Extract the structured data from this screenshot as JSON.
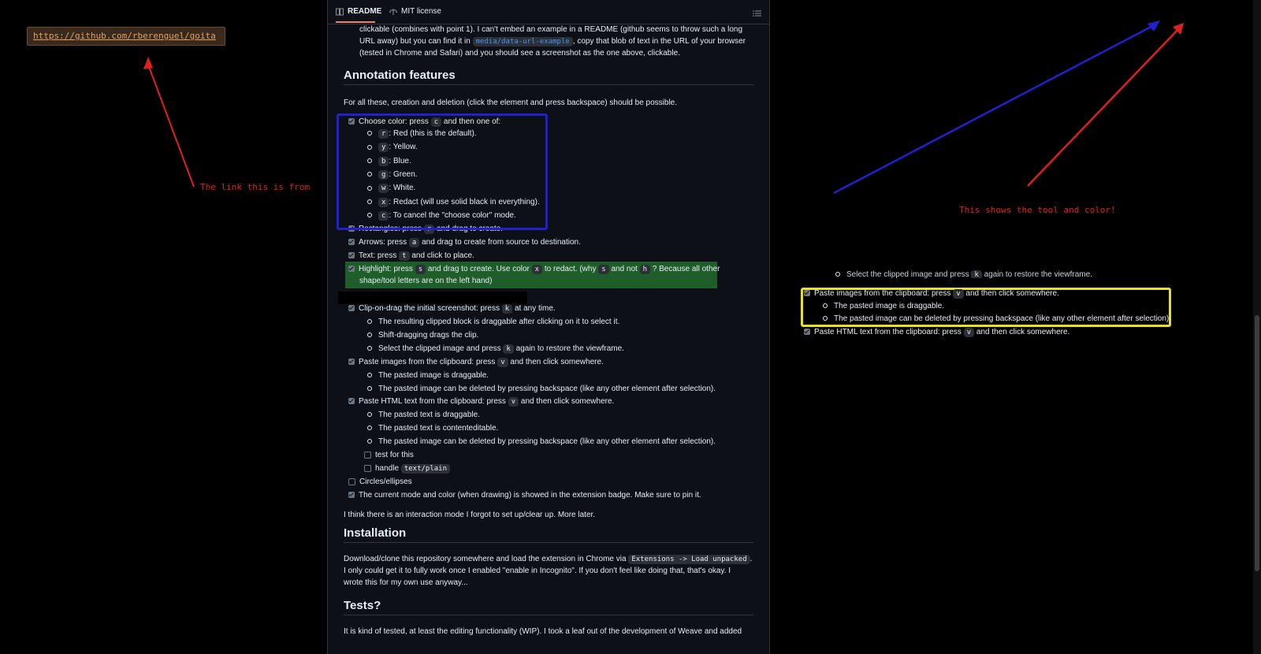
{
  "colors": {
    "page_bg": "#0d1117",
    "outer_bg": "#000000",
    "annotation_red": "#e0201e",
    "annotation_blue": "#2020d0",
    "annotation_yellow": "#e8e020",
    "highlight_green": "#1f5d2a",
    "link_blue": "#4493f8"
  },
  "annotations": {
    "url_box": "https://github.com/rberenguel/goita",
    "link_note": "The link this is from",
    "tool_note": "This shows the tool and color!"
  },
  "tabs": {
    "readme": "README",
    "license": "MIT license",
    "readme_icon": "book-icon",
    "license_icon": "scale-icon",
    "toc_icon": "list-icon"
  },
  "intro": {
    "line1": "clickable (combines with point 1). I can't embed an example in a README (github seems to throw such a long",
    "line2_a": "URL away) but you can find it in",
    "line2_link": "media/data-url-example",
    "line2_b": ", copy that blob of text in the URL of your browser",
    "line3": "(tested in Chrome and Safari) and you should see a screenshot as the one above, clickable."
  },
  "annotation_features": {
    "heading": "Annotation features",
    "intro": "For all these, creation and deletion (click the element and press backspace) should be possible.",
    "choose_color": {
      "a": "Choose color: press",
      "key": "c",
      "b": "and then one of:"
    },
    "colors": [
      {
        "key": "r",
        "text": ": Red (this is the default)."
      },
      {
        "key": "y",
        "text": ": Yellow."
      },
      {
        "key": "b",
        "text": ": Blue."
      },
      {
        "key": "g",
        "text": ": Green."
      },
      {
        "key": "w",
        "text": ": White."
      },
      {
        "key": "x",
        "text": ": Redact (will use solid black in everything)."
      },
      {
        "key": "c",
        "text": ": To cancel the \"choose color\" mode."
      }
    ],
    "rectangles": {
      "a": "Rectangles: press",
      "key": "r",
      "b": "and drag to create."
    },
    "arrows": {
      "a": "Arrows: press",
      "key": "a",
      "b": "and drag to create from source to destination."
    },
    "text": {
      "a": "Text: press",
      "key": "t",
      "b": "and click to place."
    },
    "highlight": {
      "a": "Highlight: press",
      "key1": "s",
      "b": "and drag to create. Use color",
      "key2": "x",
      "c": "to redact. (why",
      "key3": "s",
      "d": "and not",
      "key4": "h",
      "e": "? Because all other",
      "line2": "shape/tool letters are on the left hand)"
    },
    "clip": {
      "a": "Clip-on-drag the initial screenshot: press",
      "key": "k",
      "b": "at any time."
    },
    "clip_sub": [
      "The resulting clipped block is draggable after clicking on it to select it.",
      "Shift-dragging drags the clip."
    ],
    "clip_restore": {
      "a": "Select the clipped image and press",
      "key": "k",
      "b": "again to restore the viewframe."
    },
    "paste_images": {
      "a": "Paste images from the clipboard: press",
      "key": "v",
      "b": "and then click somewhere."
    },
    "paste_images_sub": [
      "The pasted image is draggable.",
      "The pasted image can be deleted by pressing backspace (like any other element after selection)."
    ],
    "paste_html": {
      "a": "Paste HTML text from the clipboard: press",
      "key": "v",
      "b": "and then click somewhere."
    },
    "paste_html_sub": [
      "The pasted text is draggable.",
      "The pasted text is contenteditable.",
      "The pasted image can be deleted by pressing backspace (like any other element after selection)."
    ],
    "todo_test": "test for this",
    "todo_handle": {
      "a": "handle",
      "code": "text/plain"
    },
    "circles": "Circles/ellipses",
    "badge": "The current mode and color (when drawing) is showed in the extension badge. Make sure to pin it.",
    "outro": "I think there is an interaction mode I forgot to set up/clear up. More later."
  },
  "installation": {
    "heading": "Installation",
    "a": "Download/clone this repository somewhere and load the extension in Chrome via",
    "code": "Extensions -> Load unpacked",
    "b": ".",
    "line2": "I only could get it to fully work once I enabled \"enable in Incognito\". If you don't feel like doing that, that's okay. I",
    "line3": "wrote this for my own use anyway..."
  },
  "tests": {
    "heading": "Tests?",
    "line1": "It is kind of tested, at least the editing functionality (WIP). I took a leaf out of the development of Weave and added"
  },
  "right_clip": {
    "restore": {
      "a": "Select the clipped image and press",
      "key": "k",
      "b": "again to restore the viewframe."
    },
    "paste_images": {
      "a": "Paste images from the clipboard: press",
      "key": "v",
      "b": "and then click somewhere."
    },
    "sub": [
      "The pasted image is draggable.",
      "The pasted image can be deleted by pressing backspace (like any other element after selection)"
    ],
    "paste_html": {
      "a": "Paste HTML text from the clipboard: press",
      "key": "v",
      "b": "and then click somewhere."
    }
  }
}
